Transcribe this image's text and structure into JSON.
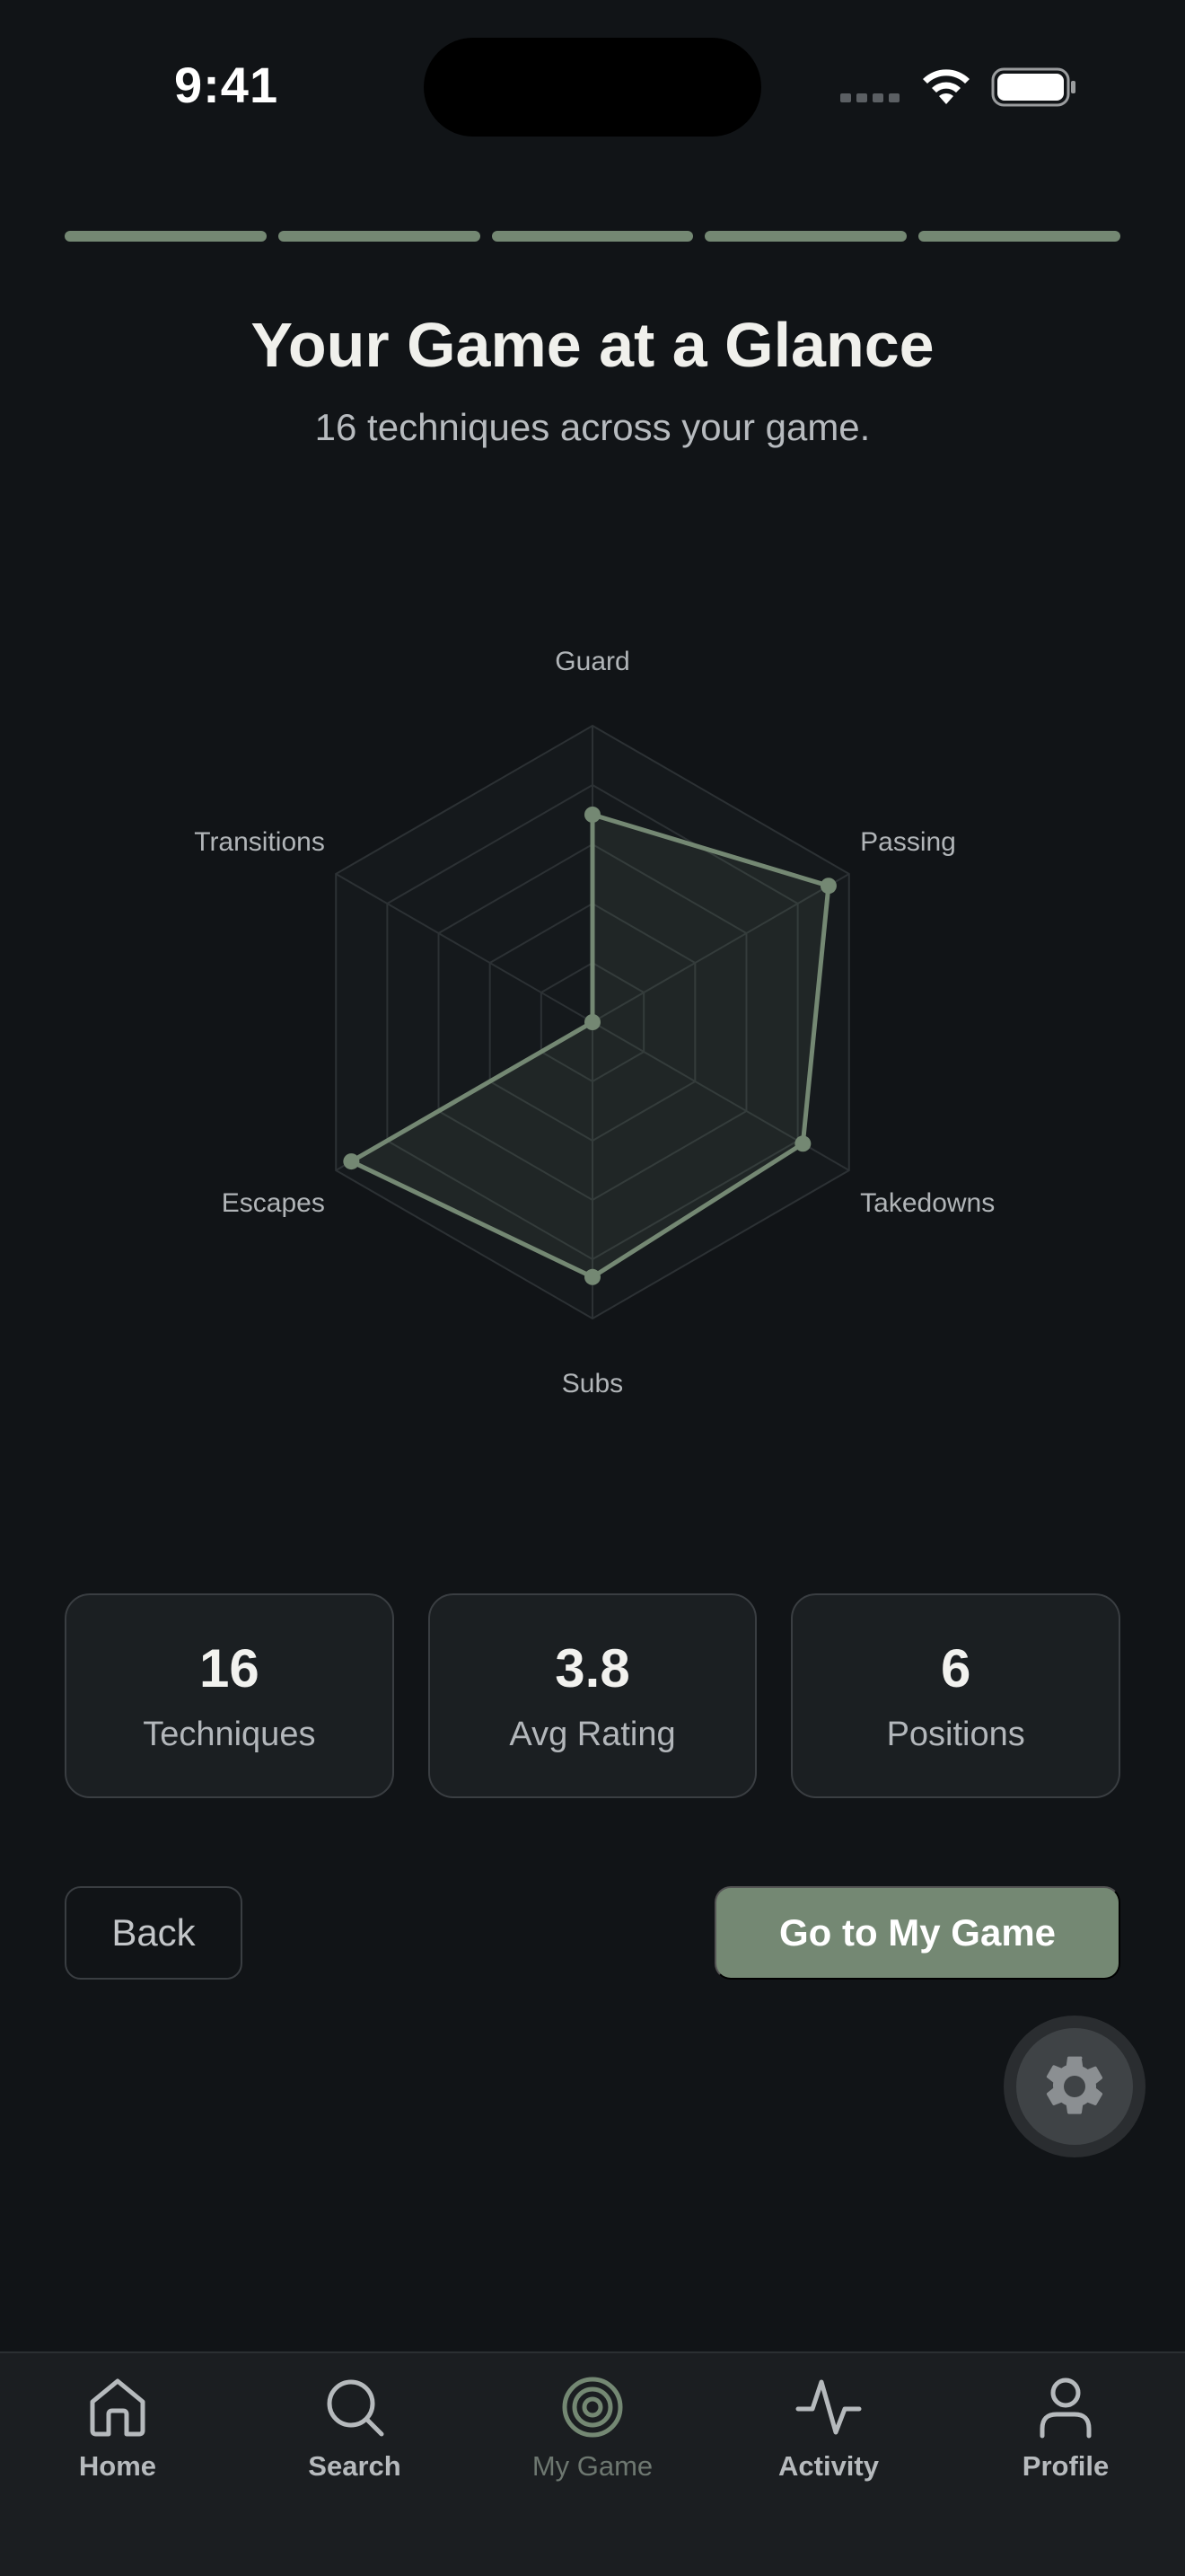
{
  "status_bar": {
    "time": "9:41"
  },
  "onboarding": {
    "steps_total": 5,
    "steps_complete": 5
  },
  "header": {
    "title": "Your Game at a Glance",
    "subtitle": "16 techniques across your game."
  },
  "chart_data": {
    "type": "radar",
    "axes": [
      "Guard",
      "Passing",
      "Takedowns",
      "Subs",
      "Escapes",
      "Transitions"
    ],
    "values": [
      3.5,
      4.6,
      4.1,
      4.3,
      4.7,
      0
    ],
    "range": [
      0,
      5
    ],
    "rings": 5,
    "grid": true,
    "series_color": "#748873"
  },
  "stats": [
    {
      "value": "16",
      "label": "Techniques"
    },
    {
      "value": "3.8",
      "label": "Avg Rating"
    },
    {
      "value": "6",
      "label": "Positions"
    }
  ],
  "actions": {
    "back_label": "Back",
    "primary_label": "Go to My Game"
  },
  "fab": {
    "icon": "gear-icon"
  },
  "tabbar": {
    "items": [
      {
        "label": "Home",
        "icon": "home-icon"
      },
      {
        "label": "Search",
        "icon": "search-icon"
      },
      {
        "label": "My Game",
        "icon": "target-icon",
        "active": true
      },
      {
        "label": "Activity",
        "icon": "activity-icon"
      },
      {
        "label": "Profile",
        "icon": "profile-icon"
      }
    ]
  },
  "colors": {
    "background": "#111417",
    "accent": "#748873",
    "card": "#1b1f22",
    "border": "#3a3e42"
  }
}
